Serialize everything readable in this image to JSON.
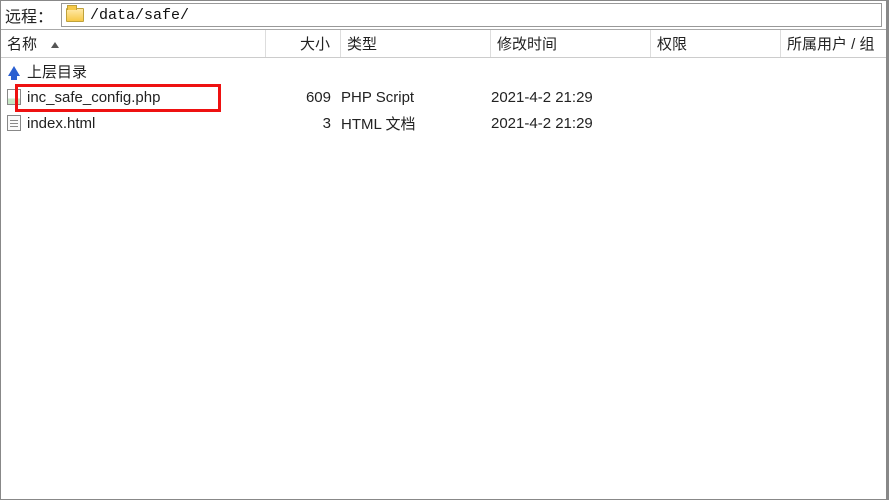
{
  "pathbar": {
    "label": "远程：",
    "path": "/data/safe/"
  },
  "columns": {
    "name": "名称",
    "size": "大小",
    "type": "类型",
    "modified": "修改时间",
    "permissions": "权限",
    "owner": "所属用户 / 组"
  },
  "parent_dir": {
    "label": "上层目录"
  },
  "files": [
    {
      "name": "inc_safe_config.php",
      "size": "609",
      "type": "PHP Script",
      "modified": "2021-4-2 21:29",
      "permissions": "",
      "owner": ""
    },
    {
      "name": "index.html",
      "size": "3",
      "type": "HTML 文档",
      "modified": "2021-4-2 21:29",
      "permissions": "",
      "owner": ""
    }
  ]
}
